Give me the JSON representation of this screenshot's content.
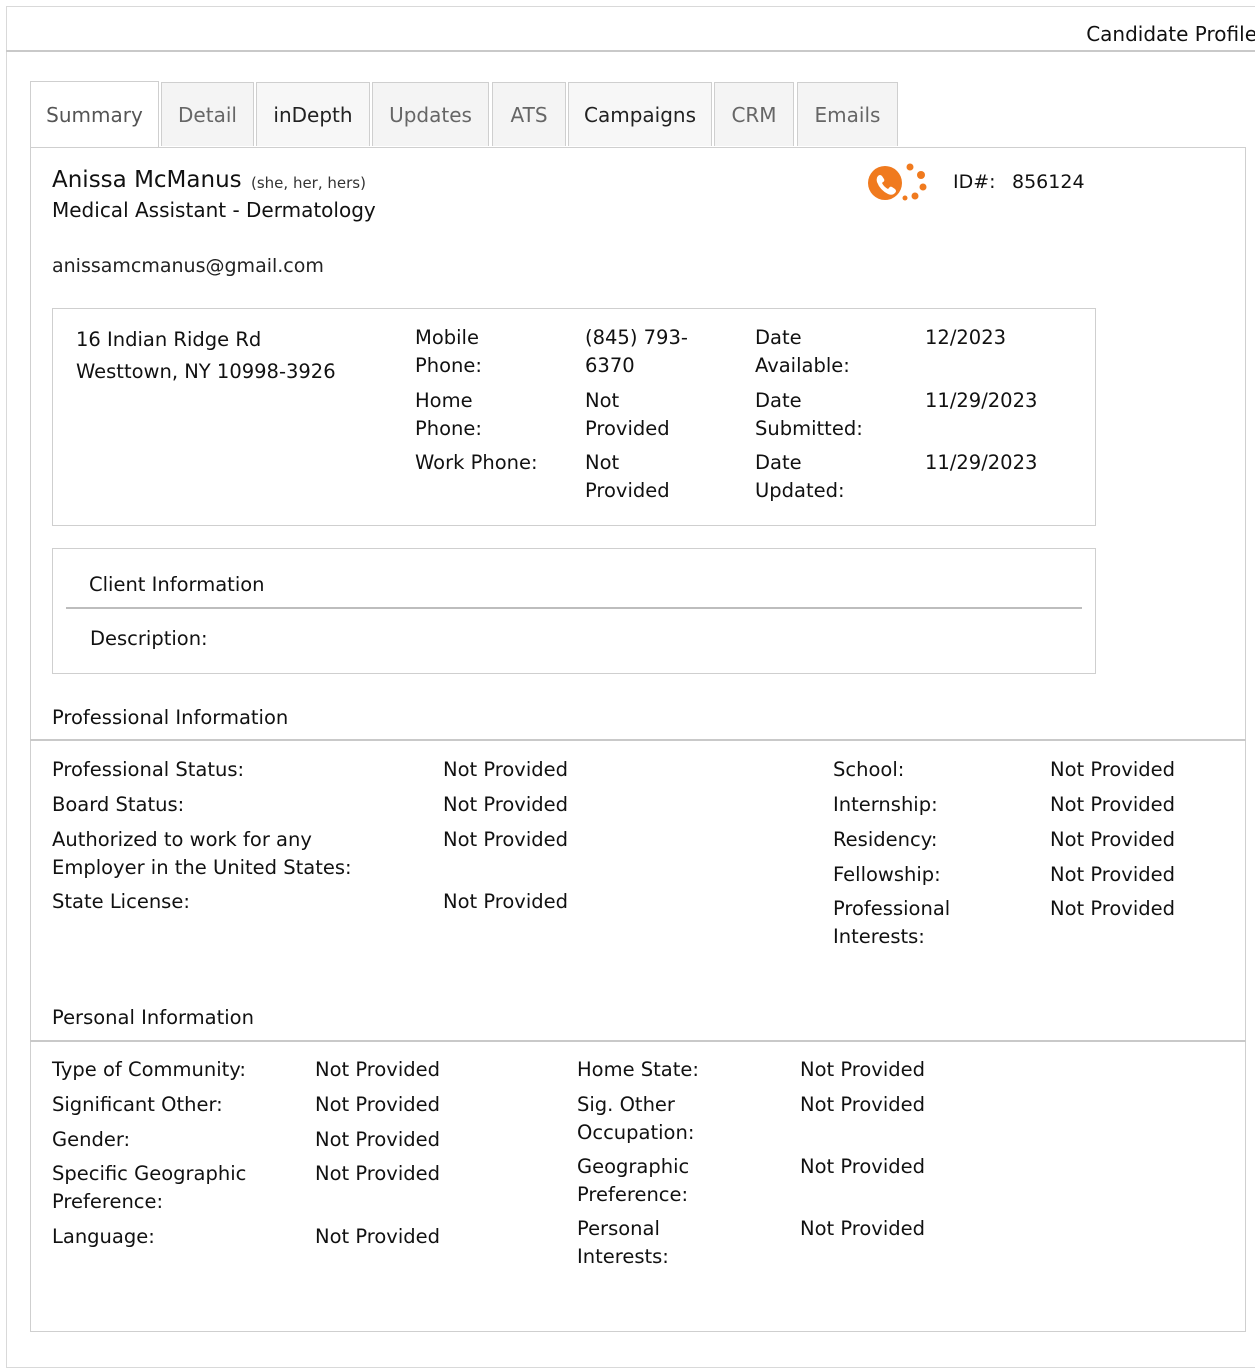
{
  "header": {
    "title": "Candidate Profile"
  },
  "tabs": [
    {
      "label": "Summary"
    },
    {
      "label": "Detail"
    },
    {
      "label": "inDepth"
    },
    {
      "label": "Updates"
    },
    {
      "label": "ATS"
    },
    {
      "label": "Campaigns"
    },
    {
      "label": "CRM"
    },
    {
      "label": "Emails"
    }
  ],
  "candidate": {
    "name": "Anissa McManus",
    "pronouns": "(she, her, hers)",
    "job_title": "Medical Assistant - Dermatology",
    "email": "anissamcmanus@gmail.com",
    "id_label": "ID#:",
    "id_value": "856124",
    "address_line1": "16 Indian Ridge Rd",
    "address_line2": "Westtown, NY 10998-3926"
  },
  "contact": {
    "mobile_label_1": "Mobile",
    "mobile_label_2": "Phone:",
    "mobile_value_1": "(845) 793-",
    "mobile_value_2": "6370",
    "home_label_1": "Home",
    "home_label_2": "Phone:",
    "home_value_1": "Not",
    "home_value_2": "Provided",
    "work_label": "Work Phone:",
    "work_value_1": "Not",
    "work_value_2": "Provided",
    "avail_label_1": "Date",
    "avail_label_2": "Available:",
    "avail_value": "12/2023",
    "submitted_label_1": "Date",
    "submitted_label_2": "Submitted:",
    "submitted_value": "11/29/2023",
    "updated_label_1": "Date",
    "updated_label_2": "Updated:",
    "updated_value": "11/29/2023"
  },
  "client": {
    "title": "Client Information",
    "description_label": "Description:"
  },
  "professional": {
    "title": "Professional Information",
    "prof_status_label": "Professional Status:",
    "prof_status_value": "Not Provided",
    "board_label": "Board Status:",
    "board_value": "Not Provided",
    "auth_label_1": "Authorized to work for any",
    "auth_label_2": "Employer in the United States:",
    "auth_value": "Not Provided",
    "license_label": "State License:",
    "license_value": "Not Provided",
    "school_label": "School:",
    "school_value": "Not Provided",
    "internship_label": "Internship:",
    "internship_value": "Not Provided",
    "residency_label": "Residency:",
    "residency_value": "Not Provided",
    "fellowship_label": "Fellowship:",
    "fellowship_value": "Not Provided",
    "interests_label_1": "Professional",
    "interests_label_2": "Interests:",
    "interests_value": "Not Provided"
  },
  "personal": {
    "title": "Personal Information",
    "community_label": "Type of Community:",
    "community_value": "Not Provided",
    "sig_other_label": "Significant Other:",
    "sig_other_value": "Not Provided",
    "gender_label": "Gender:",
    "gender_value": "Not Provided",
    "spec_geo_label_1": "Specific Geographic",
    "spec_geo_label_2": "Preference:",
    "spec_geo_value": "Not Provided",
    "language_label": "Language:",
    "language_value": "Not Provided",
    "home_state_label": "Home State:",
    "home_state_value": "Not Provided",
    "sig_occ_label_1": "Sig. Other",
    "sig_occ_label_2": "Occupation:",
    "sig_occ_value": "Not Provided",
    "geo_label_1": "Geographic",
    "geo_label_2": "Preference:",
    "geo_value": "Not Provided",
    "pers_int_label_1": "Personal",
    "pers_int_label_2": "Interests:",
    "pers_int_value": "Not Provided"
  },
  "colors": {
    "accent_orange": "#f07a1e"
  },
  "icons": {
    "phone_badge": "phone-icon"
  }
}
